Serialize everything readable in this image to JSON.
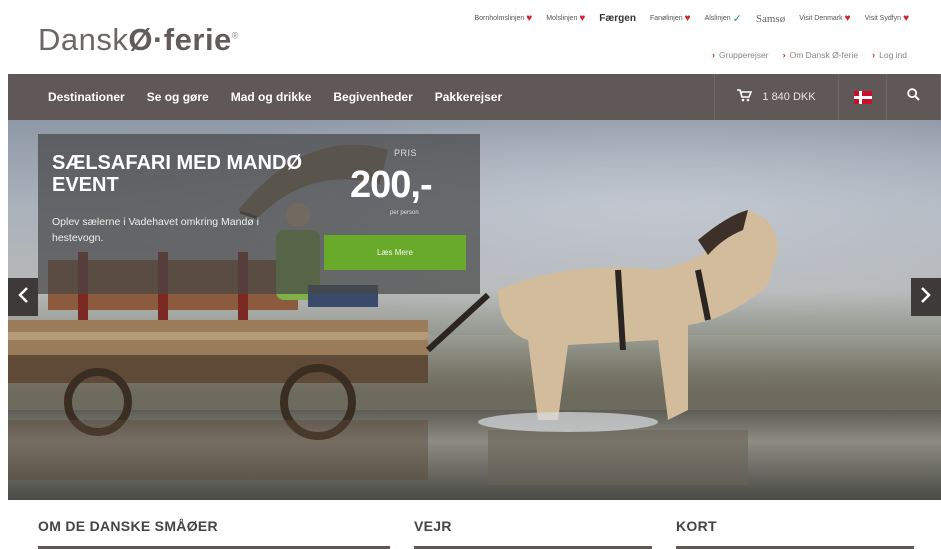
{
  "header": {
    "logo": {
      "part1": "Dansk",
      "part2": "Ø·ferie",
      "reg": "®"
    },
    "partners": [
      {
        "name": "Bornholmslinjen",
        "icon": "heart"
      },
      {
        "name": "Molslinjen",
        "icon": "heart"
      },
      {
        "name": "Færgen",
        "icon": "none"
      },
      {
        "name": "Fanølinjen",
        "icon": "heart"
      },
      {
        "name": "Alslinjen",
        "icon": "check"
      },
      {
        "name": "Samsø",
        "icon": "none"
      },
      {
        "name": "Visit Denmark",
        "icon": "heart"
      },
      {
        "name": "Visit Sydfyn",
        "icon": "heart"
      }
    ],
    "toplinks": [
      "Grupperejser",
      "Om Dansk Ø-ferie",
      "Log ind"
    ]
  },
  "nav": {
    "items": [
      "Destinationer",
      "Se og gøre",
      "Mad og drikke",
      "Begivenheder",
      "Pakkerejser"
    ],
    "cart_total": "1 840 DKK"
  },
  "hero": {
    "title": "SÆLSAFARI MED MANDØ EVENT",
    "description": "Oplev sælerne i Vadehavet omkring Mandø i hestevogn.",
    "price_label": "PRIS",
    "price": "200,-",
    "price_unit": "per person",
    "cta": "Læs Mere"
  },
  "sections": [
    "OM DE DANSKE SMÅØER",
    "VEJR",
    "KORT"
  ],
  "colors": {
    "nav_bg": "#5f5856",
    "accent_red": "#c8302c",
    "cta_green": "#6aaa2b"
  }
}
